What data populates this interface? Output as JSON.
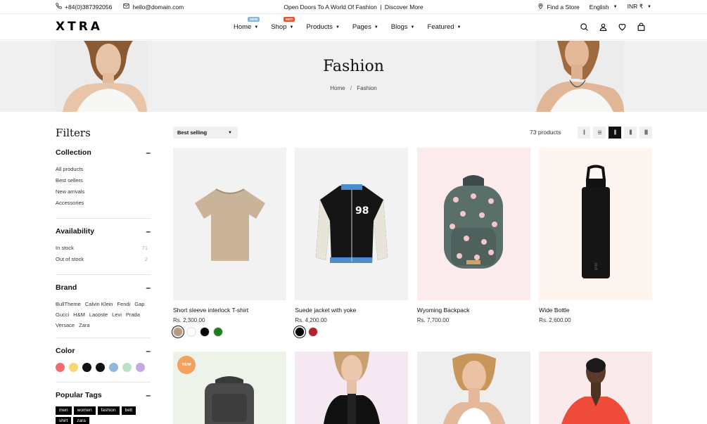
{
  "topbar": {
    "phone": "+84(0)387392056",
    "email": "hello@domain.com",
    "promo_text": "Open Doors To A World Of Fashion",
    "promo_link": "Discover More",
    "find_store": "Find a Store",
    "language": "English",
    "currency": "INR ₹"
  },
  "header": {
    "logo": "XTRA",
    "nav": [
      {
        "label": "Home",
        "badge": "NEW"
      },
      {
        "label": "Shop",
        "badge": "HOT"
      },
      {
        "label": "Products"
      },
      {
        "label": "Pages"
      },
      {
        "label": "Blogs"
      },
      {
        "label": "Featured"
      }
    ],
    "icons": [
      "search-icon",
      "user-icon",
      "heart-icon",
      "bag-icon"
    ]
  },
  "banner": {
    "title": "Fashion",
    "breadcrumb_home": "Home",
    "breadcrumb_sep": "/",
    "breadcrumb_current": "Fashion"
  },
  "filters": {
    "title": "Filters",
    "collection": {
      "heading": "Collection",
      "items": [
        "All products",
        "Best sellers",
        "New arrivals",
        "Accessories"
      ]
    },
    "availability": {
      "heading": "Availability",
      "items": [
        {
          "label": "In stock",
          "count": "71"
        },
        {
          "label": "Out of stock",
          "count": "2"
        }
      ]
    },
    "brand": {
      "heading": "Brand",
      "items": [
        "BullTheme",
        "Calvin Klein",
        "Fendi",
        "Gap",
        "Gucci",
        "H&M",
        "Lacoste",
        "Levi",
        "Prada",
        "Versace",
        "Zara"
      ]
    },
    "color": {
      "heading": "Color",
      "swatches": [
        "#f26b6b",
        "#f7d774",
        "#111111",
        "#111111",
        "#8fb8de",
        "#b9e3c6",
        "#c5a8e8"
      ]
    },
    "tags": {
      "heading": "Popular Tags",
      "items": [
        "men",
        "women",
        "fashion",
        "belt",
        "shirt",
        "zara"
      ]
    }
  },
  "toolbar": {
    "sort_label": "Best selling",
    "product_count": "73 products",
    "active_view": 2
  },
  "products": [
    {
      "name": "Short sleeve interlock T-shirt",
      "price": "Rs. 2,300.00",
      "bg": "#f2f2f2",
      "swatches": [
        "#b79b7d",
        "#ffffff",
        "#000000",
        "#1e7d1e"
      ],
      "selected": 0
    },
    {
      "name": "Suede jacket with yoke",
      "price": "Rs. 4,200.00",
      "bg": "#f2f2f2",
      "swatches": [
        "#000000",
        "#b0232a"
      ],
      "selected": 0
    },
    {
      "name": "Wyoming Backpack",
      "price": "Rs. 7,700.00",
      "bg": "#fcebed",
      "swatches": []
    },
    {
      "name": "Wide Bottle",
      "price": "Rs. 2,600.00",
      "bg": "#fdf6f0",
      "swatches": []
    }
  ],
  "row2": [
    {
      "bg": "#eef3e9",
      "badge": "NEW"
    },
    {
      "bg": "#f6e8f2"
    },
    {
      "bg": "#eeeeee"
    },
    {
      "bg": "#fbeaec"
    }
  ]
}
